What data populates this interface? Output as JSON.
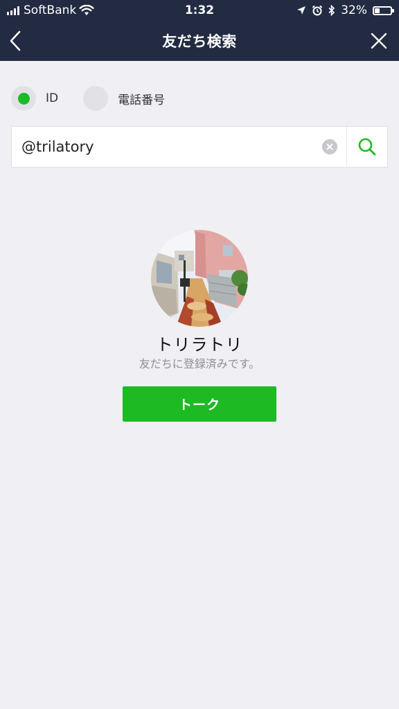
{
  "status_bar": {
    "carrier": "SoftBank",
    "time": "1:32",
    "battery_percent": "32%",
    "battery_level": 0.32,
    "icons": [
      "signal-icon",
      "wifi-icon",
      "location-icon",
      "alarm-icon",
      "bluetooth-icon",
      "battery-icon"
    ]
  },
  "nav": {
    "title": "友だち検索",
    "back_icon": "chevron-left-icon",
    "close_icon": "close-icon"
  },
  "search_type": {
    "options": [
      {
        "label": "ID",
        "selected": true
      },
      {
        "label": "電話番号",
        "selected": false
      }
    ]
  },
  "search": {
    "value": "@trilatory",
    "clear_icon": "clear-icon",
    "search_icon": "search-icon"
  },
  "result": {
    "name": "トリラトリ",
    "status": "友だちに登録済みです。",
    "button_label": "トーク"
  },
  "colors": {
    "nav_background": "#222b42",
    "page_background": "#efeff4",
    "accent_green": "#1dba23",
    "radio_selected": "#19bc24"
  }
}
